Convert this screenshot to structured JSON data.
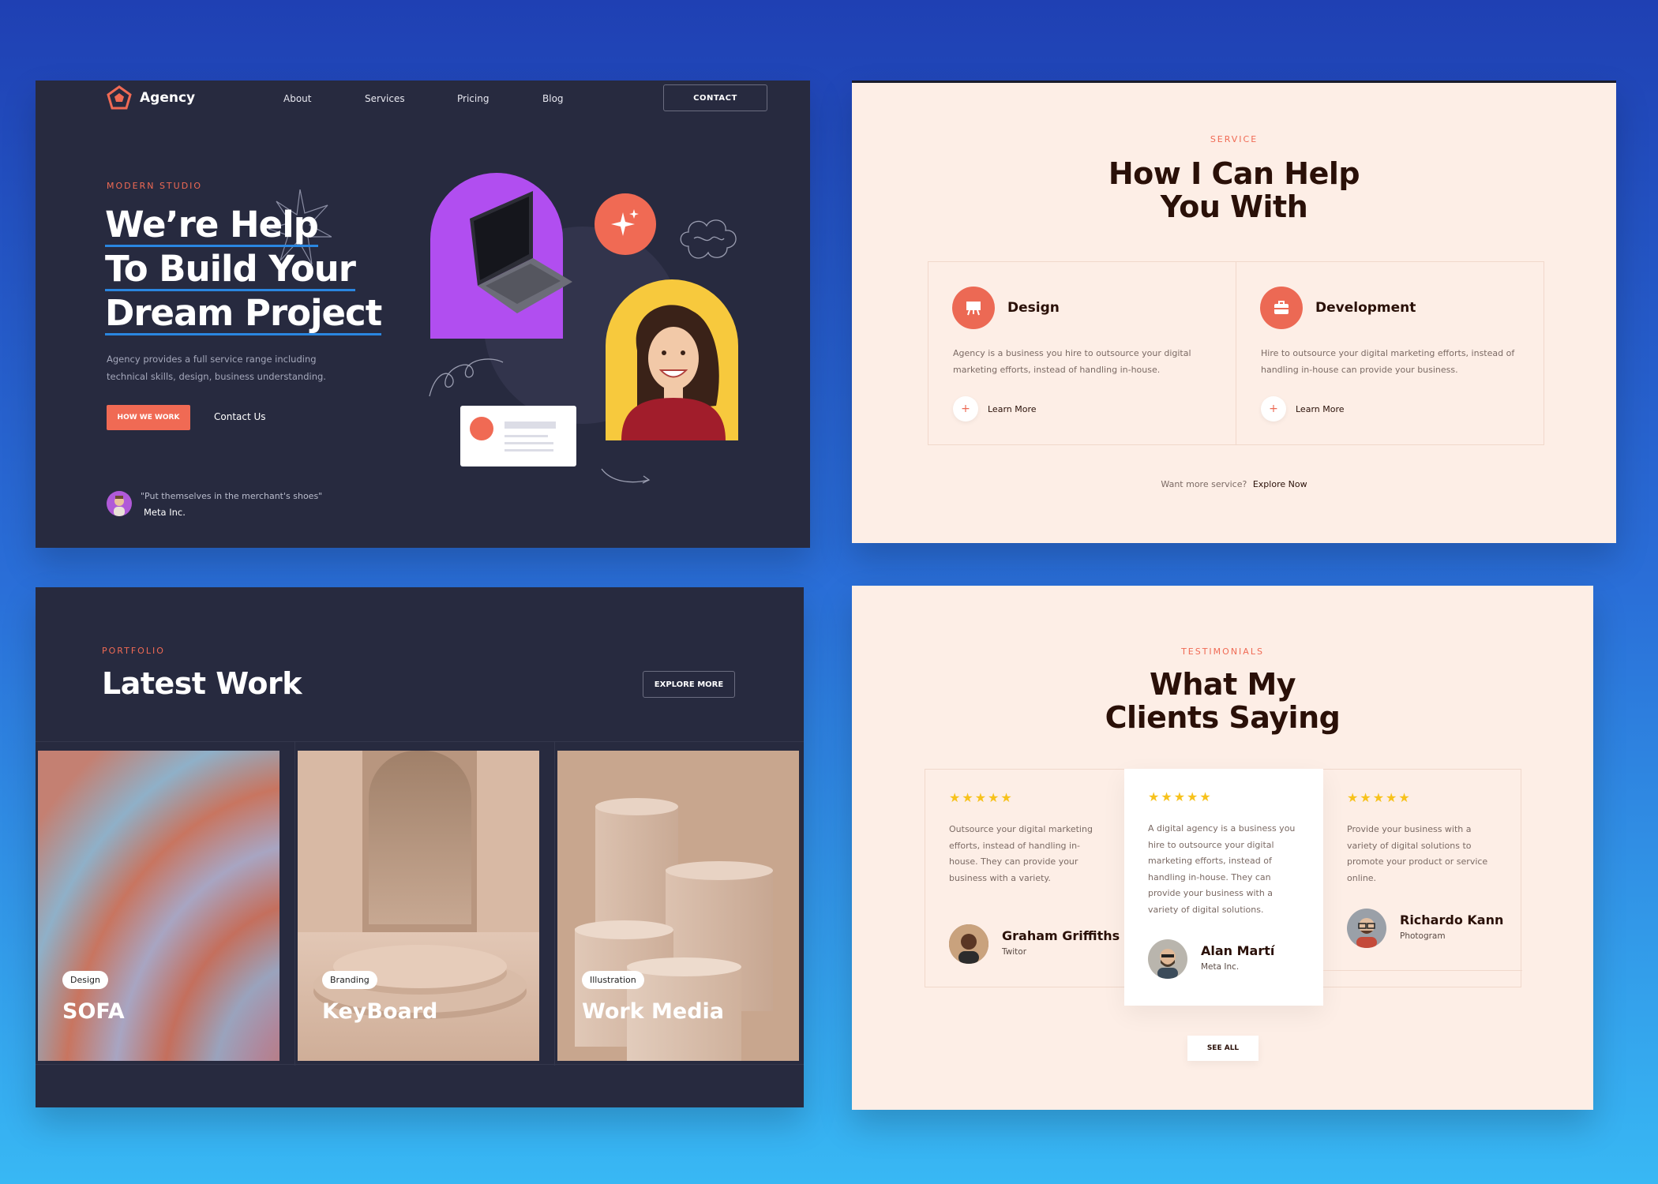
{
  "hero": {
    "brand": "Agency",
    "nav": [
      "About",
      "Services",
      "Pricing",
      "Blog"
    ],
    "contact_button": "CONTACT",
    "eyebrow": "MODERN STUDIO",
    "title_lines": [
      "We’re Help",
      "To Build Your",
      "Dream Project"
    ],
    "description": "Agency provides a full service range including technical skills, design, business understanding.",
    "primary_button": "HOW WE WORK",
    "secondary_link": "Contact Us",
    "quote": "\"Put themselves in the merchant's shoes\"",
    "quote_author": "Meta Inc."
  },
  "service": {
    "eyebrow": "SERVICE",
    "title_lines": [
      "How I Can Help",
      "You With"
    ],
    "items": [
      {
        "name": "Design",
        "icon": "easel-icon",
        "description": "Agency is a business you hire to outsource your digital marketing efforts, instead of handling in-house.",
        "link": "Learn More"
      },
      {
        "name": "Development",
        "icon": "briefcase-icon",
        "description": "Hire to outsource your digital marketing efforts, instead of handling in-house can provide your business.",
        "link": "Learn More"
      }
    ],
    "more_text": "Want more service?",
    "more_link": "Explore Now"
  },
  "portfolio": {
    "eyebrow": "PORTFOLIO",
    "title": "Latest Work",
    "button": "EXPLORE MORE",
    "items": [
      {
        "tag": "Design",
        "name": "SOFA"
      },
      {
        "tag": "Branding",
        "name": "KeyBoard"
      },
      {
        "tag": "Illustration",
        "name": "Work Media"
      }
    ]
  },
  "testimonials": {
    "eyebrow": "TESTIMONIALS",
    "title_lines": [
      "What My",
      "Clients Saying"
    ],
    "stars": "★★★★★",
    "items": [
      {
        "text": "Outsource your digital marketing efforts, instead of handling in-house. They can provide your business with a variety.",
        "name": "Graham Griffiths",
        "role": "Twitor"
      },
      {
        "text": "A digital agency is a business you hire to outsource your digital marketing efforts, instead of handling in-house. They can provide your business with a variety of digital solutions.",
        "name": "Alan Martí",
        "role": "Meta Inc."
      },
      {
        "text": "Provide your business with a variety of digital solutions to promote your product or service online.",
        "name": "Richardo Kann",
        "role": "Photogram"
      }
    ],
    "button": "SEE ALL"
  },
  "colors": {
    "accent": "#f06a54",
    "dark": "#272a3f",
    "cream": "#fdeee6",
    "star": "#f7c21c"
  }
}
